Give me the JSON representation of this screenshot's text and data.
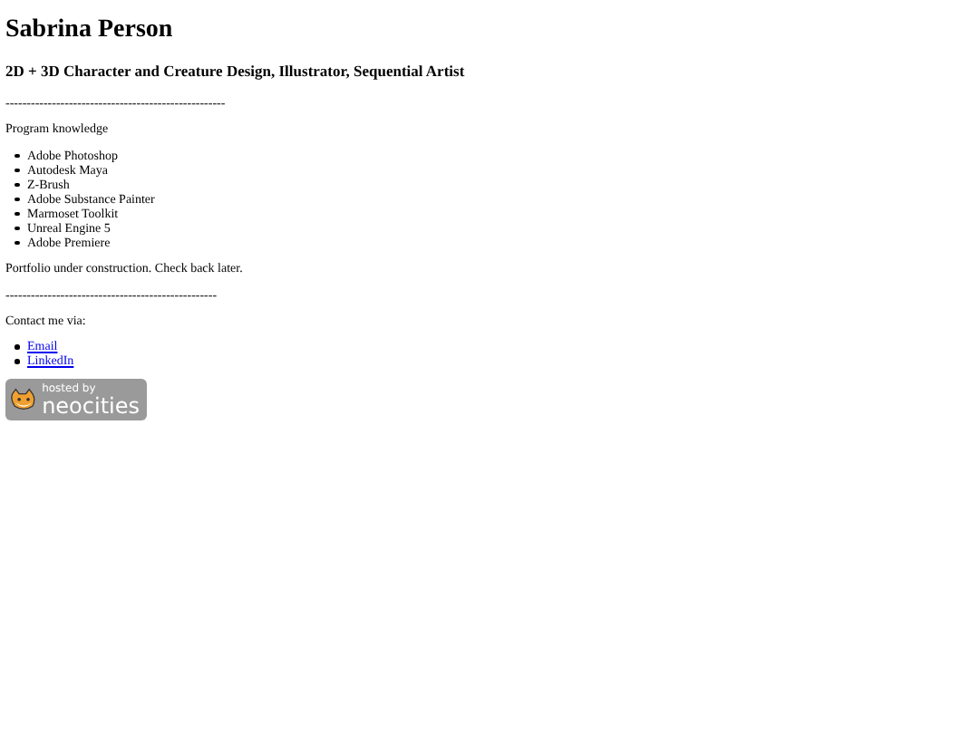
{
  "title": "Sabrina Person",
  "subtitle": "2D + 3D Character and Creature Design, Illustrator, Sequential Artist",
  "divider_1": "----------------------------------------------------",
  "programs_heading": "Program knowledge",
  "programs": [
    "Adobe Photoshop",
    "Autodesk Maya",
    "Z-Brush",
    "Adobe Substance Painter",
    "Marmoset Toolkit",
    "Unreal Engine 5",
    "Adobe Premiere"
  ],
  "status": "Portfolio under construction. Check back later.",
  "divider_2": "--------------------------------------------------",
  "contact_heading": "Contact me via:",
  "contact_links": [
    "Email",
    "LinkedIn"
  ],
  "badge": {
    "line_1": "hosted by",
    "line_2": "neocities"
  }
}
